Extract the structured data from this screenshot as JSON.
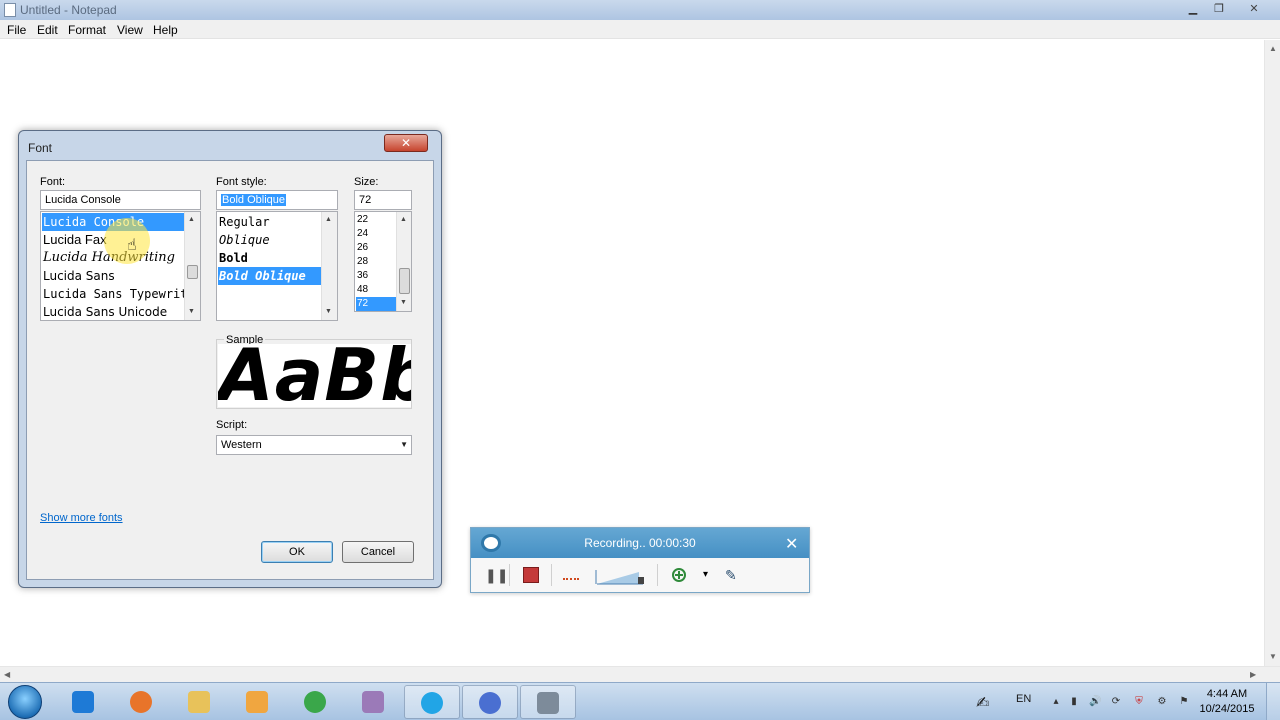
{
  "notepad": {
    "title": "Untitled - Notepad",
    "menu": [
      "File",
      "Edit",
      "Format",
      "View",
      "Help"
    ],
    "controls": {
      "minimize": "▁",
      "maximize": "❐",
      "close": "✕"
    }
  },
  "font_dialog": {
    "title": "Font",
    "close": "✕",
    "font_label": "Font:",
    "font_value": "Lucida Console",
    "fonts": [
      "Lucida Console",
      "Lucida Fax",
      "Lucida Handwriting",
      "Lucida Sans",
      "Lucida Sans Typewriter",
      "Lucida Sans Unicode"
    ],
    "style_label": "Font style:",
    "style_value": "Bold Oblique",
    "styles": [
      "Regular",
      "Oblique",
      "Bold",
      "Bold Oblique"
    ],
    "size_label": "Size:",
    "size_value": "72",
    "sizes": [
      "22",
      "24",
      "26",
      "28",
      "36",
      "48",
      "72"
    ],
    "sample_label": "Sample",
    "sample_text": "AaBbYyZz",
    "script_label": "Script:",
    "script_value": "Western",
    "show_more": "Show more fonts",
    "ok": "OK",
    "cancel": "Cancel"
  },
  "recorder": {
    "status": "Recording.. 00:00:30",
    "close": "✕",
    "pause": "❚❚",
    "pen": "✎",
    "dropdown": "▾"
  },
  "taskbar": {
    "language": "EN",
    "time": "4:44 AM",
    "date": "10/24/2015",
    "colors": {
      "ie": "#1e7ad6",
      "firefox": "#e8742a",
      "explorer": "#e8c25a",
      "media": "#f0a640",
      "chrome": "#3aa74a",
      "paint": "#9b7ab8",
      "skype": "#21a5e6",
      "itunes": "#4a6fd1",
      "notepad": "#7d8b9a"
    }
  }
}
